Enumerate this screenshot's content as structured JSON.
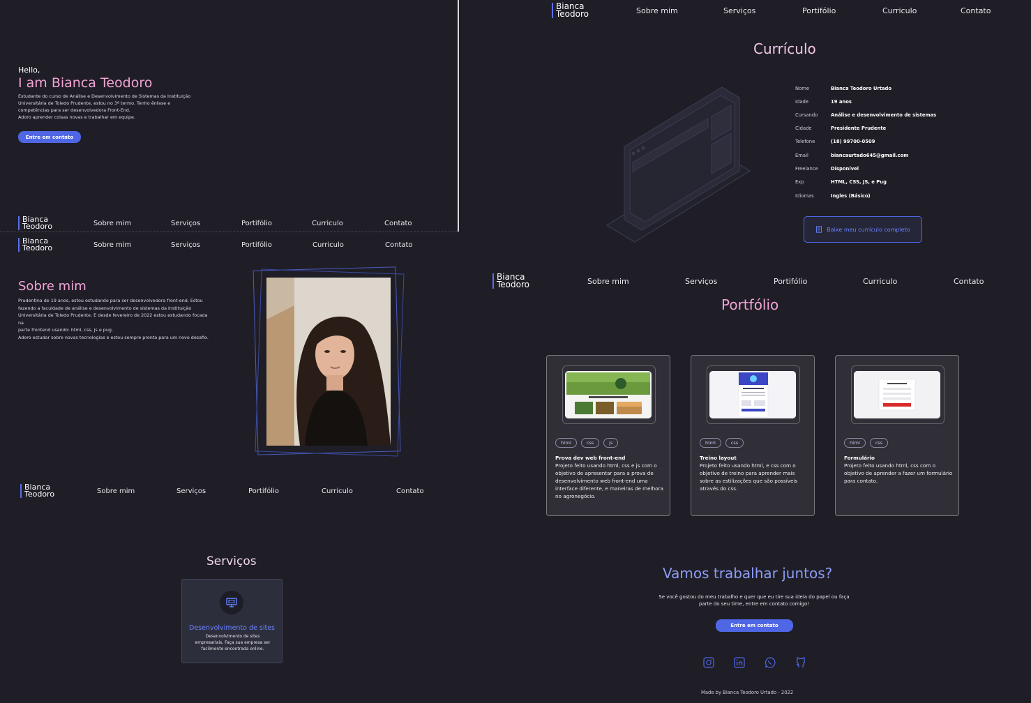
{
  "nav": {
    "logo_line1": "Bianca",
    "logo_line2": "Teodoro",
    "items": [
      "Sobre mim",
      "Serviços",
      "Portifólio",
      "Curriculo",
      "Contato"
    ]
  },
  "hero": {
    "greeting": "Hello,",
    "title": "I am Bianca Teodoro",
    "description_lines": [
      "Estudante do curso de Análise e Desenvolvimento de Sistemas da Instituição",
      "Universitária de Toledo Prudente, estou no 3º termo. Tenho ênfase e",
      "competências para ser desenvolvedora Front-End.",
      "Adoro aprender coisas novas e trabalhar em equipe."
    ],
    "button": "Entre em contato"
  },
  "sobre": {
    "title": "Sobre mim",
    "paragraph1_lines": [
      "Prudentina de 19 anos, estou estudando para ser desenvolvedora front-end. Estou",
      "fazendo a faculdade de análise e desenvolvimento de sistemas da Instituição",
      "Universitária de Toledo Prudente. E desde fevereiro de 2022 estou estudando focada na",
      "parte frontend usando: html, css, js e pug."
    ],
    "paragraph2": "Adoro estudar sobre novas tecnologias e estou sempre pronta para um novo desafio."
  },
  "servicos": {
    "title": "Serviços",
    "card_title": "Desenvolvimento de sites",
    "card_desc": "Desenvolvimento de sites empresariais. Faça sua empresa ser facilmente encontrada online.",
    "card_icon": "monitor-icon"
  },
  "curriculo": {
    "title": "Currículo",
    "rows": [
      {
        "k": "Nome",
        "v": "Bianca Teodoro Urtado"
      },
      {
        "k": "Idade",
        "v": "19 anos"
      },
      {
        "k": "Cursando",
        "v": "Análise e desenvolvimento de sistemas"
      },
      {
        "k": "Cidade",
        "v": "Presidente Prudente"
      },
      {
        "k": "Telefone",
        "v": "(18) 99700-0509"
      },
      {
        "k": "Email",
        "v": "biancaurtado645@gmail.com"
      },
      {
        "k": "Freelance",
        "v": "Disponível"
      },
      {
        "k": "Exp",
        "v": "HTML, CSS, JS, e Pug"
      },
      {
        "k": "Idiomas",
        "v": "Ingles (Básico)"
      }
    ],
    "download_button": "Baixe meu currículo completo"
  },
  "portfolio": {
    "title": "Portfólio",
    "projects": [
      {
        "tags": [
          "html",
          "css",
          "js"
        ],
        "title": "Prova dev web front-end",
        "desc": "Projeto feito usando html, css e js com o objetivo de apresentar para a prova de desenvolvimento web front-end uma interface diferente, e maneiras de melhora no agronegócio."
      },
      {
        "tags": [
          "html",
          "css"
        ],
        "title": "Treino layout",
        "desc": "Projeto feito usando html, e css com o objetivo de treino para aprender mais sobre as estilizações que são possíveis através do css."
      },
      {
        "tags": [
          "html",
          "css"
        ],
        "title": "Formulário",
        "desc": "Projeto feito usando html, css com o objetivo de aprender a fazer um formulário para contato."
      }
    ]
  },
  "contact": {
    "title": "Vamos trabalhar juntos?",
    "text_line1": "Se você gostou do meu trabalho e quer que eu tire sua ideia do papel ou faça",
    "text_line2": "parte do seu time, entre em contato comigo!",
    "button": "Entre em contato",
    "socials": [
      "instagram-icon",
      "linkedin-icon",
      "whatsapp-icon",
      "github-icon"
    ],
    "footer": "Made by Bianca Teodoro Urtado - 2022"
  },
  "colors": {
    "background": "#1f1e27",
    "pink": "#f2a3d6",
    "blue_accent": "#4f67e5",
    "link_blue": "#6a83ff"
  }
}
